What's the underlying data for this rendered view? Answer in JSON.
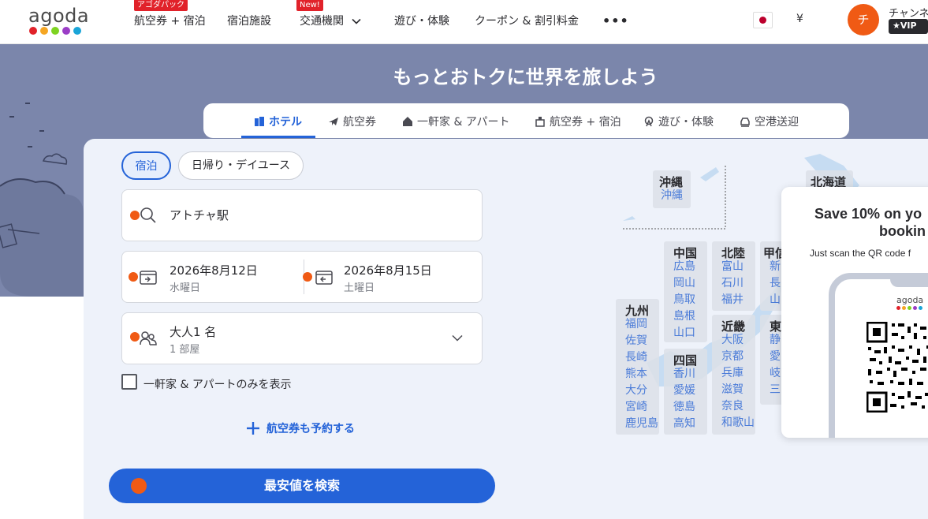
{
  "header": {
    "logo": "agoda",
    "nav": [
      {
        "label": "航空券 + 宿泊",
        "badge": "アゴダパック"
      },
      {
        "label": "宿泊施設",
        "badge": ""
      },
      {
        "label": "交通機関",
        "badge": "New!"
      },
      {
        "label": "遊び・体験",
        "badge": ""
      },
      {
        "label": "クーポン & 割引料金",
        "badge": ""
      }
    ],
    "more": "•••",
    "currency": "¥",
    "avatar_initial": "チ",
    "username": "チャンネ",
    "vip_label": "VIP"
  },
  "hero": {
    "title": "もっとおトクに世界を旅しよう"
  },
  "tabs": [
    "ホテル",
    "航空券",
    "一軒家 & アパート",
    "航空券 + 宿泊",
    "遊び・体験",
    "空港送迎"
  ],
  "search": {
    "stay_types": [
      "宿泊",
      "日帰り・デイユース"
    ],
    "destination": "アトチャ駅",
    "checkin_date": "2026年8月12日",
    "checkin_day": "水曜日",
    "checkout_date": "2026年8月15日",
    "checkout_day": "土曜日",
    "guests": "大人1 名",
    "rooms": "1 部屋",
    "homes_only_label": "一軒家 & アパートのみを表示",
    "add_flight_label": "航空券も予約する",
    "search_button": "最安値を検索"
  },
  "map": {
    "regions": [
      {
        "name": "沖縄",
        "cities": [
          "沖縄"
        ]
      },
      {
        "name": "北海道",
        "cities": []
      },
      {
        "name": "中国",
        "cities": [
          "広島",
          "岡山",
          "鳥取",
          "島根",
          "山口"
        ]
      },
      {
        "name": "北陸",
        "cities": [
          "富山",
          "石川",
          "福井"
        ]
      },
      {
        "name": "甲信",
        "cities": [
          "新",
          "長",
          "山"
        ]
      },
      {
        "name": "九州",
        "cities": [
          "福岡",
          "佐賀",
          "長崎",
          "熊本",
          "大分",
          "宮崎",
          "鹿児島"
        ]
      },
      {
        "name": "四国",
        "cities": [
          "香川",
          "愛媛",
          "徳島",
          "高知"
        ]
      },
      {
        "name": "近畿",
        "cities": [
          "大阪",
          "京都",
          "兵庫",
          "滋賀",
          "奈良",
          "和歌山"
        ]
      },
      {
        "name": "東",
        "cities": [
          "静",
          "愛",
          "岐",
          "三"
        ]
      }
    ]
  },
  "popup": {
    "title_line1": "Save 10% on yo",
    "title_line2": "bookin",
    "subtitle": "Just scan the QR code f",
    "phone_logo": "agoda"
  },
  "colors": {
    "accent": "#2463d8",
    "orange": "#f05a14",
    "hero_bg": "#7b86ab"
  }
}
